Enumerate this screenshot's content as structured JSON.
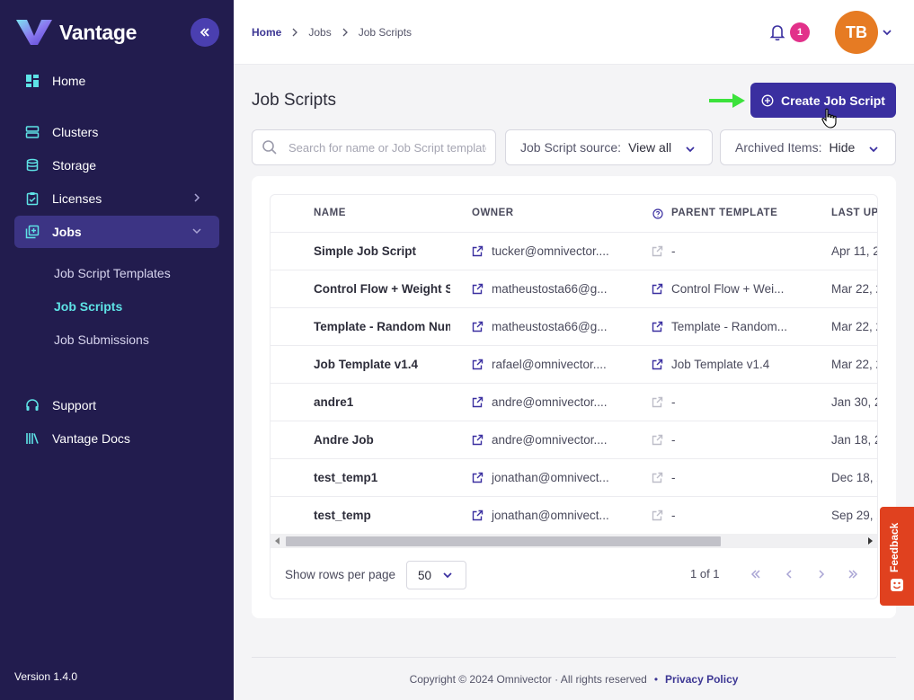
{
  "app": {
    "name": "Vantage",
    "version": "Version 1.4.0"
  },
  "sidebar": {
    "items": [
      {
        "label": "Home",
        "icon": "grid-icon"
      },
      {
        "label": "Clusters",
        "icon": "server-icon"
      },
      {
        "label": "Storage",
        "icon": "database-icon"
      },
      {
        "label": "Licenses",
        "icon": "clipboard-icon"
      },
      {
        "label": "Jobs",
        "icon": "layers-icon"
      },
      {
        "label": "Support",
        "icon": "headset-icon"
      },
      {
        "label": "Vantage Docs",
        "icon": "books-icon"
      }
    ],
    "jobs_sub": [
      "Job Script Templates",
      "Job Scripts",
      "Job Submissions"
    ]
  },
  "header": {
    "breadcrumb": [
      "Home",
      "Jobs",
      "Job Scripts"
    ],
    "notification_count": "1",
    "avatar_initials": "TB"
  },
  "main": {
    "title": "Job Scripts",
    "create_button": "Create Job Script",
    "search_placeholder": "Search for name or Job Script template",
    "filters": [
      {
        "label": "Job Script source:",
        "value": "View all"
      },
      {
        "label": "Archived Items:",
        "value": "Hide"
      }
    ]
  },
  "table": {
    "columns": [
      "NAME",
      "OWNER",
      "PARENT TEMPLATE",
      "LAST UP"
    ],
    "rows": [
      {
        "name": "Simple Job Script",
        "owner": "tucker@omnivector....",
        "parent": "-",
        "updated": "Apr 11, 2"
      },
      {
        "name": "Control Flow + Weight Sl",
        "owner": "matheustosta66@g...",
        "parent": "Control Flow + Wei...",
        "updated": "Mar 22, 2"
      },
      {
        "name": "Template - Random Num",
        "owner": "matheustosta66@g...",
        "parent": "Template - Random...",
        "updated": "Mar 22, 2"
      },
      {
        "name": "Job Template v1.4",
        "owner": "rafael@omnivector....",
        "parent": "Job Template v1.4",
        "updated": "Mar 22, 2"
      },
      {
        "name": "andre1",
        "owner": "andre@omnivector....",
        "parent": "-",
        "updated": "Jan 30, 2"
      },
      {
        "name": "Andre Job",
        "owner": "andre@omnivector....",
        "parent": "-",
        "updated": "Jan 18, 2"
      },
      {
        "name": "test_temp1",
        "owner": "jonathan@omnivect...",
        "parent": "-",
        "updated": "Dec 18, 2"
      },
      {
        "name": "test_temp",
        "owner": "jonathan@omnivect...",
        "parent": "-",
        "updated": "Sep 29, 2"
      }
    ],
    "rows_per_page_label": "Show rows per page",
    "rows_per_page": "50",
    "page_info": "1 of 1"
  },
  "feedback": {
    "label": "Feedback"
  },
  "footer": {
    "copyright": "Copyright © 2024 Omnivector · All rights reserved",
    "separator": "•",
    "privacy": "Privacy Policy"
  },
  "colors": {
    "sidebar": "#221c4e",
    "accent": "#3a2fa0",
    "active_sub": "#5ee3e6",
    "badge": "#e2318a",
    "avatar": "#e67b23",
    "feedback": "#e0411f"
  }
}
